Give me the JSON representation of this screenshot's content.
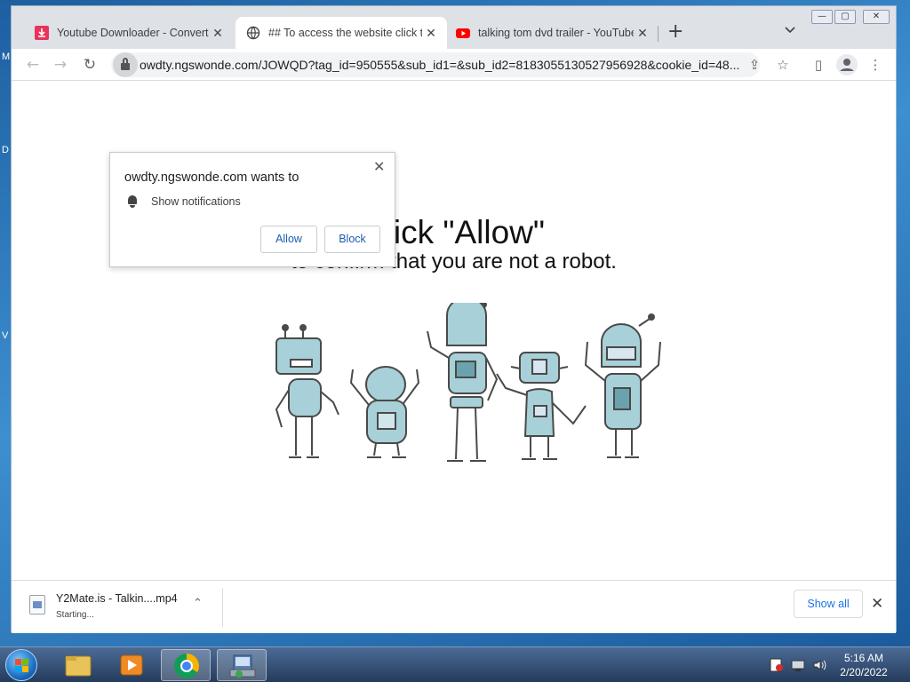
{
  "desktop": {
    "side_chars": [
      "M",
      "D",
      "V"
    ]
  },
  "browser": {
    "tabs": [
      {
        "title": "Youtube Downloader - Convert & Download Youtube Videos",
        "icon": "download-icon",
        "color": "#e8335c"
      },
      {
        "title": "## To access the website click the Allow button",
        "icon": "globe-icon"
      },
      {
        "title": "talking tom dvd trailer - YouTube",
        "icon": "youtube-icon",
        "color": "#ff0000"
      }
    ],
    "close_glyph": "✕",
    "newtab_glyph": "+",
    "tablist_glyph": "⌄",
    "window_controls": [
      "—",
      "▢",
      "✕"
    ],
    "url": "owdty.ngswonde.com/JOWQD?tag_id=950555&sub_id1=&sub_id2=8183055130527956928&cookie_id=48...",
    "nav": {
      "back": "←",
      "forward": "→",
      "reload": "↻"
    },
    "toolbar_icons": {
      "share": "⇪",
      "bookmark": "☆",
      "sidepanel": "▯",
      "profile": "👤",
      "menu": "⋮"
    }
  },
  "permission_popup": {
    "title": "owdty.ngswonde.com wants to",
    "close": "✕",
    "permission": "Show notifications",
    "allow": "Allow",
    "block": "Block"
  },
  "page": {
    "headline": "Click \"Allow\"",
    "subheadline": "to confirm that you are not a robot."
  },
  "download_shelf": {
    "file_name": "Y2Mate.is - Talkin....mp4",
    "status": "Starting...",
    "chevron": "⌃",
    "show_all": "Show all",
    "close": "✕"
  },
  "taskbar": {
    "time": "5:16 AM",
    "date": "2/20/2022"
  }
}
